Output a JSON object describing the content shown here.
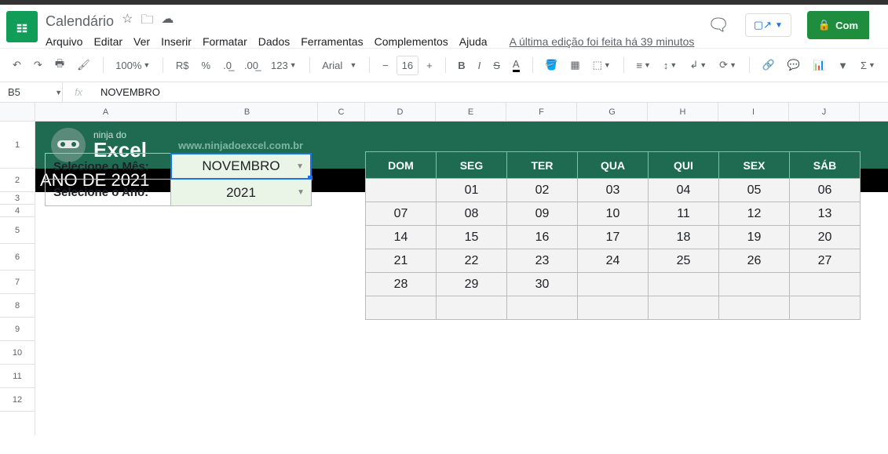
{
  "doc_title": "Calendário",
  "menus": [
    "Arquivo",
    "Editar",
    "Ver",
    "Inserir",
    "Formatar",
    "Dados",
    "Ferramentas",
    "Complementos",
    "Ajuda"
  ],
  "edit_status": "A última edição foi feita há 39 minutos",
  "share_label": "Com",
  "toolbar": {
    "zoom": "100%",
    "currency": "R$",
    "percent": "%",
    "dec_minus": ".0",
    "dec_plus": ".00",
    "numfmt": "123",
    "font": "Arial",
    "fontsize": "16"
  },
  "namebox": "B5",
  "formula_value": "NOVEMBRO",
  "columns": [
    "A",
    "B",
    "C",
    "D",
    "E",
    "F",
    "G",
    "H",
    "I",
    "J"
  ],
  "rows": [
    "1",
    "2",
    "3",
    "4",
    "5",
    "6",
    "7",
    "8",
    "9",
    "10",
    "11",
    "12"
  ],
  "brand": {
    "small": "ninja do",
    "big": "Excel",
    "url": "www.ninjadoexcel.com.br"
  },
  "blackbar": "ANO DE 2021",
  "selectors": {
    "month_label": "Selecione o Mês:",
    "month_value": "NOVEMBRO",
    "year_label": "Selecione o Ano:",
    "year_value": "2021"
  },
  "calendar": {
    "headers": [
      "DOM",
      "SEG",
      "TER",
      "QUA",
      "QUI",
      "SEX",
      "SÁB"
    ],
    "rows": [
      [
        "",
        "01",
        "02",
        "03",
        "04",
        "05",
        "06"
      ],
      [
        "07",
        "08",
        "09",
        "10",
        "11",
        "12",
        "13"
      ],
      [
        "14",
        "15",
        "16",
        "17",
        "18",
        "19",
        "20"
      ],
      [
        "21",
        "22",
        "23",
        "24",
        "25",
        "26",
        "27"
      ],
      [
        "28",
        "29",
        "30",
        "",
        "",
        "",
        ""
      ],
      [
        "",
        "",
        "",
        "",
        "",
        "",
        ""
      ]
    ]
  }
}
